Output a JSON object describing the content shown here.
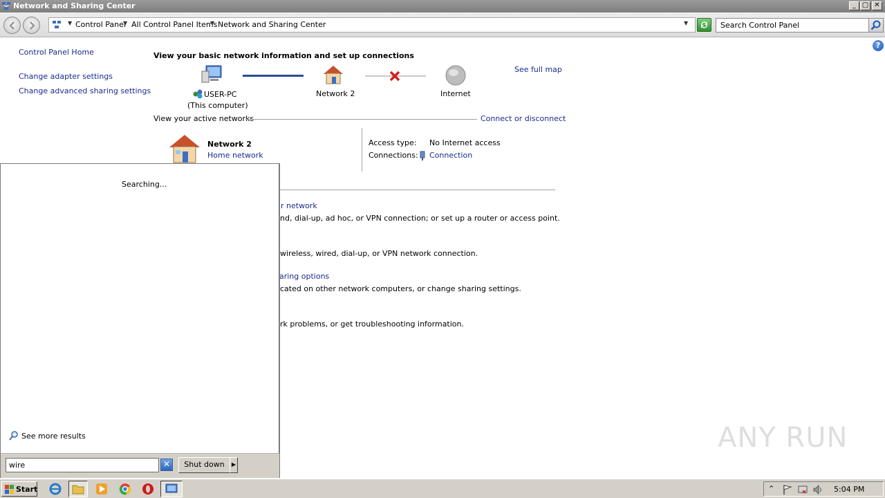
{
  "window": {
    "title": "Network and Sharing Center",
    "controls": [
      "_",
      "▢",
      "✕"
    ]
  },
  "address": {
    "crumbs": [
      "Control Panel",
      "All Control Panel Items",
      "Network and Sharing Center"
    ],
    "search_placeholder": "Search Control Panel"
  },
  "left_pane": {
    "home": "Control Panel Home",
    "links": [
      "Change adapter settings",
      "Change advanced sharing settings"
    ]
  },
  "main": {
    "heading": "View your basic network information and set up connections",
    "see_full_map": "See full map",
    "map": {
      "computer": "USER-PC",
      "computer_note": "(This computer)",
      "network": "Network  2",
      "internet": "Internet"
    },
    "active_networks_label": "View your active networks",
    "connect_link": "Connect or disconnect",
    "active_network": {
      "name": "Network  2",
      "type": "Home network",
      "access_label": "Access type:",
      "access_value": "No Internet access",
      "connections_label": "Connections:",
      "connections_value": "Connection"
    },
    "tasks": [
      {
        "link": "r network",
        "desc": "nd, dial-up, ad hoc, or VPN connection; or set up a router or access point."
      },
      {
        "link": "",
        "desc": "wireless, wired, dial-up, or VPN network connection."
      },
      {
        "link": "aring options",
        "desc": "cated on other network computers, or change sharing settings."
      },
      {
        "link": "",
        "desc": "rk problems, or get troubleshooting information."
      }
    ]
  },
  "start_menu": {
    "status": "Searching...",
    "see_more": "See more results",
    "search_value": "wire",
    "shutdown": "Shut down",
    "arrow": "▶"
  },
  "taskbar": {
    "start": "Start",
    "clock": "5:04 PM"
  },
  "watermark": "ANY RUN",
  "colors": {
    "link": "#1a2b8c",
    "title_bar": "#8a8a8a",
    "face": "#d4d0c8"
  }
}
